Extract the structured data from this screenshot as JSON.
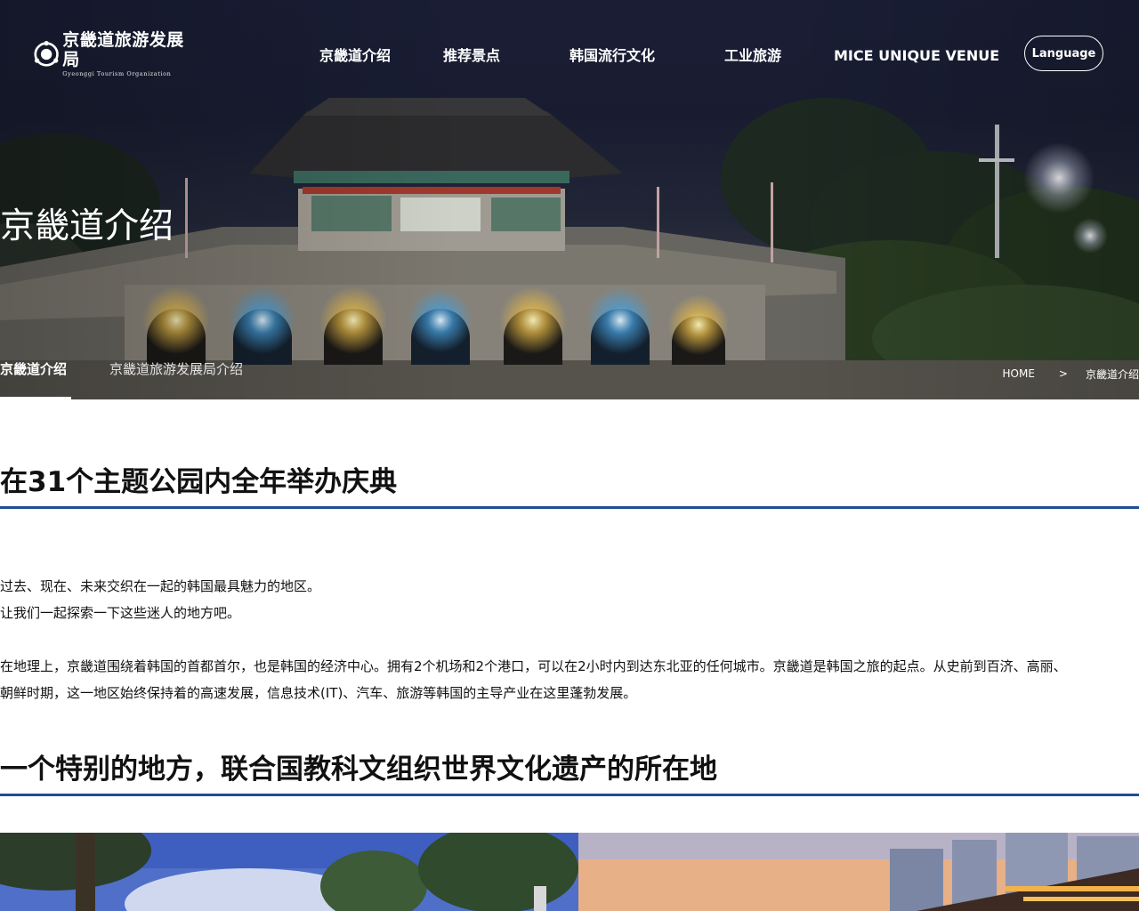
{
  "header": {
    "logo": {
      "name_cn": "京畿道旅游发展局",
      "name_en": "Gyeonggi Tourism Organization",
      "icon": "gto-logo-icon"
    },
    "nav": [
      {
        "label": "京畿道介绍"
      },
      {
        "label": "推荐景点"
      },
      {
        "label": "韩国流行文化"
      },
      {
        "label": "工业旅游"
      },
      {
        "label": "MICE UNIQUE VENUE"
      }
    ],
    "language_label": "Language"
  },
  "hero": {
    "title": "京畿道介绍",
    "subnav": [
      {
        "label": "京畿道介绍",
        "active": true
      },
      {
        "label": "京畿道旅游发展局介绍",
        "active": false
      }
    ],
    "breadcrumb": {
      "home": "HOME",
      "separator": ">",
      "current": "京畿道介绍"
    }
  },
  "sections": [
    {
      "heading": "在31个主题公园内全年举办庆典",
      "paragraphs": [
        "过去、现在、未来交织在一起的韩国最具魅力的地区。",
        "让我们一起探索一下这些迷人的地方吧。",
        "在地理上，京畿道围绕着韩国的首都首尔，也是韩国的经济中心。拥有2个机场和2个港口，可以在2小时内到达东北亚的任何城市。京畿道是韩国之旅的起点。从史前到百济、高丽、",
        "朝鲜时期，这一地区始终保持着的高速发展，信息技术(IT)、汽车、旅游等韩国的主导产业在这里蓬勃发展。"
      ]
    },
    {
      "heading": "一个特别的地方，联合国教科文组织世界文化遗产的所在地"
    }
  ],
  "colors": {
    "accent_rule": "#1f4e96",
    "hero_sky": "#1b1f38"
  }
}
